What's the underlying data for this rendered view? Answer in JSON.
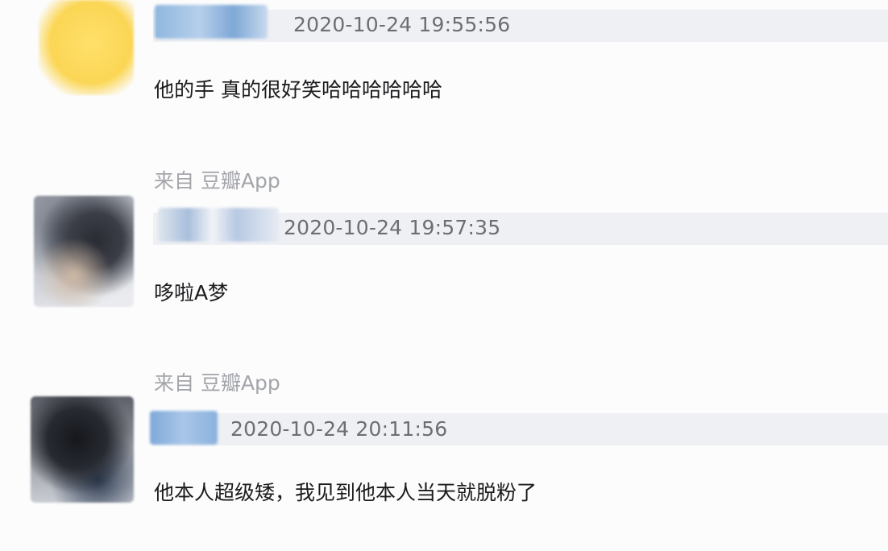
{
  "comments": [
    {
      "timestamp": "2020-10-24 19:55:56",
      "text": "他的手 真的很好笑哈哈哈哈哈哈"
    },
    {
      "source": "来自 豆瓣App",
      "timestamp": "2020-10-24 19:57:35",
      "text": "哆啦A梦"
    },
    {
      "source": "来自 豆瓣App",
      "timestamp": "2020-10-24 20:11:56",
      "text": "他本人超级矮，我见到他本人当天就脱粉了"
    }
  ],
  "colors": {
    "background": "#fcfcfd",
    "meta_bar": "#eef0f3",
    "timestamp": "#6c6e73",
    "text": "#1b1b1d",
    "source": "#a3a5aa"
  }
}
